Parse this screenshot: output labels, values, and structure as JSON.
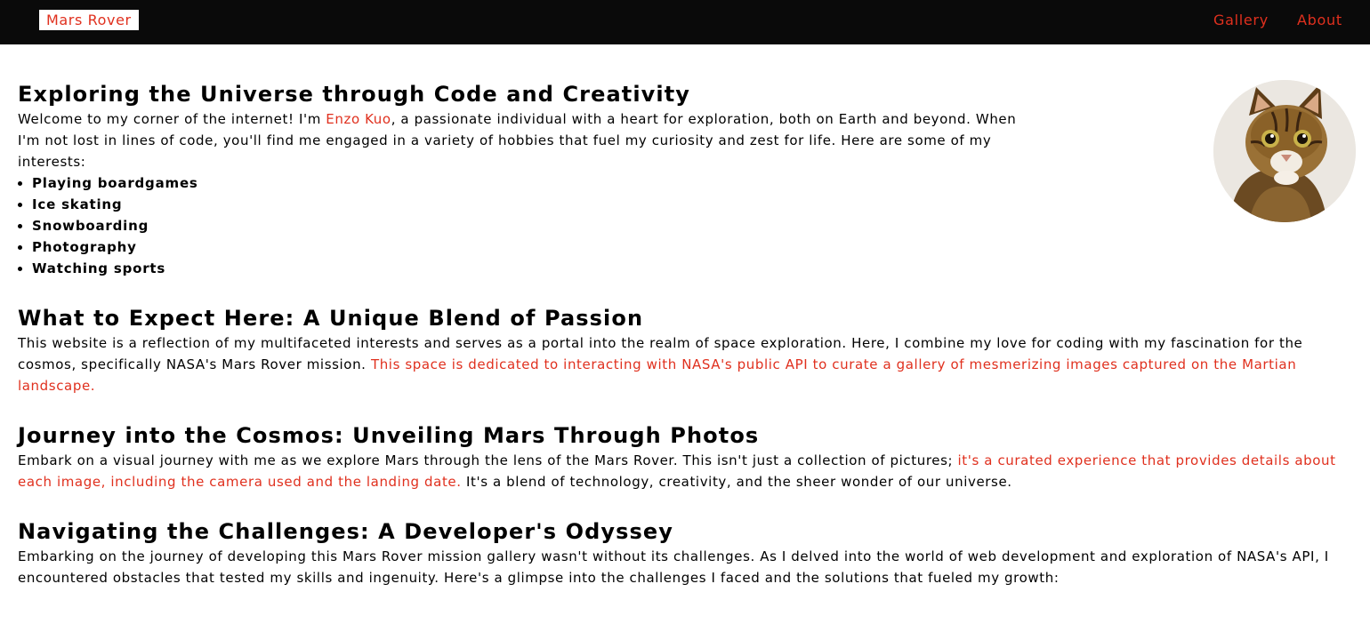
{
  "header": {
    "brand": "Mars Rover",
    "nav": [
      "Gallery",
      "About"
    ]
  },
  "sections": {
    "intro": {
      "heading": "Exploring the Universe through Code and Creativity",
      "text_before": "Welcome to my corner of the internet! I'm ",
      "name": "Enzo Kuo",
      "text_after": ", a passionate individual with a heart for exploration, both on Earth and beyond. When I'm not lost in lines of code, you'll find me engaged in a variety of hobbies that fuel my curiosity and zest for life. Here are some of my interests:",
      "hobbies": [
        "Playing boardgames",
        "Ice skating",
        "Snowboarding",
        "Photography",
        "Watching sports"
      ]
    },
    "expect": {
      "heading": "What to Expect Here: A Unique Blend of Passion",
      "text": "This website is a reflection of my multifaceted interests and serves as a portal into the realm of space exploration. Here, I combine my love for coding with my fascination for the cosmos, specifically NASA's Mars Rover mission. ",
      "highlight": "This space is dedicated to interacting with NASA's public API to curate a gallery of mesmerizing images captured on the Martian landscape."
    },
    "journey": {
      "heading": "Journey into the Cosmos: Unveiling Mars Through Photos",
      "text_before": "Embark on a visual journey with me as we explore Mars through the lens of the Mars Rover. This isn't just a collection of pictures; ",
      "highlight": "it's a curated experience that provides details about each image, including the camera used and the landing date.",
      "text_after": " It's a blend of technology, creativity, and the sheer wonder of our universe."
    },
    "challenges": {
      "heading": "Navigating the Challenges: A Developer's Odyssey",
      "text": "Embarking on the journey of developing this Mars Rover mission gallery wasn't without its challenges. As I delved into the world of web development and exploration of NASA's API, I encountered obstacles that tested my skills and ingenuity. Here's a glimpse into the challenges I faced and the solutions that fueled my growth:"
    }
  },
  "colors": {
    "accent": "#e0301e",
    "header_bg": "#0a0a0a",
    "text": "#000000"
  }
}
